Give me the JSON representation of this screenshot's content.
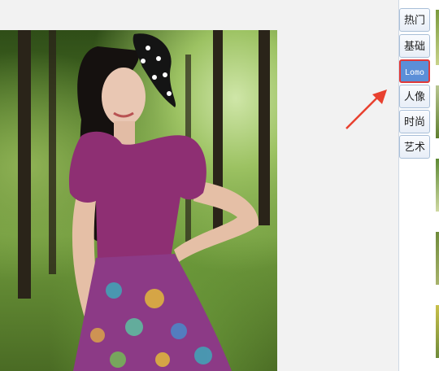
{
  "tabs": [
    {
      "label": "热门",
      "active": false
    },
    {
      "label": "基础",
      "active": false
    },
    {
      "label": "Lomo",
      "active": true
    },
    {
      "label": "人像",
      "active": false
    },
    {
      "label": "时尚",
      "active": false
    },
    {
      "label": "艺术",
      "active": false
    }
  ],
  "colors": {
    "active_tab": "#5b8fd8",
    "highlight_border": "#e03a3a",
    "arrow": "#e8412f"
  }
}
